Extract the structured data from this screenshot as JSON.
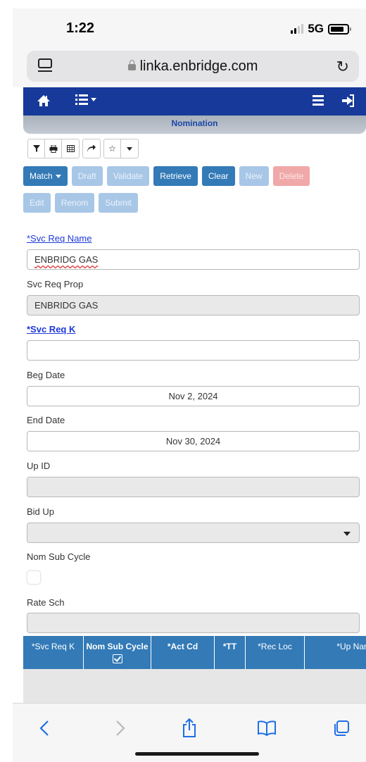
{
  "status_bar": {
    "time": "1:22",
    "network": "5G"
  },
  "browser": {
    "url": "linka.enbridge.com"
  },
  "app": {
    "title": "Nomination",
    "icons": [
      "home-icon",
      "list-menu-icon",
      "hamburger-menu-icon",
      "logout-icon"
    ]
  },
  "toolbar": {
    "buttons": [
      "filter-icon",
      "print-icon",
      "grid-icon",
      "share-icon",
      "star-icon",
      "caret-down-icon"
    ]
  },
  "actions": {
    "match": "Match",
    "draft": "Draft",
    "validate": "Validate",
    "retrieve": "Retrieve",
    "clear": "Clear",
    "new": "New",
    "delete": "Delete",
    "edit": "Edit",
    "renom": "Renom",
    "submit": "Submit"
  },
  "form": {
    "svc_req_name": {
      "label": "*Svc Req Name",
      "value": "ENBRIDG GAS"
    },
    "svc_req_prop": {
      "label": "Svc Req Prop",
      "value": "ENBRIDG GAS"
    },
    "svc_req_k": {
      "label": "*Svc Req K",
      "value": ""
    },
    "beg_date": {
      "label": "Beg Date",
      "value": "Nov 2, 2024"
    },
    "end_date": {
      "label": "End Date",
      "value": "Nov 30, 2024"
    },
    "up_id": {
      "label": "Up ID",
      "value": ""
    },
    "bid_up": {
      "label": "Bid Up",
      "value": ""
    },
    "nom_sub_cycle": {
      "label": "Nom Sub Cycle",
      "checked": false
    },
    "rate_sch": {
      "label": "Rate Sch",
      "value": ""
    }
  },
  "grid": {
    "columns": [
      "*Svc Req K",
      "Nom Sub Cycle",
      "*Act Cd",
      "*TT",
      "*Rec Loc",
      "*Up Nar"
    ]
  },
  "safari_bottom": {
    "icons": [
      "back-icon",
      "forward-icon",
      "share-icon",
      "bookmarks-icon",
      "tabs-icon"
    ]
  }
}
